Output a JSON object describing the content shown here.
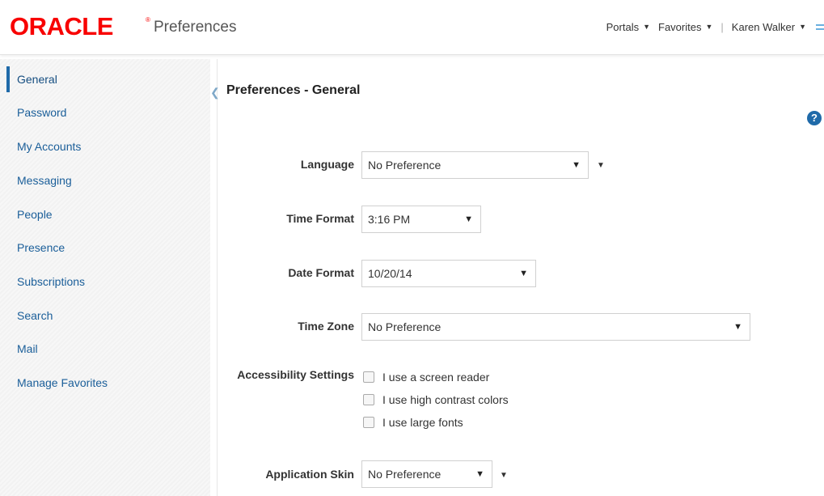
{
  "header": {
    "logo": "ORACLE",
    "logo_mark": "®",
    "title": "Preferences",
    "nav": [
      {
        "label": "Portals",
        "icon": "caret-down-icon"
      },
      {
        "label": "Favorites",
        "icon": "caret-down-icon"
      },
      {
        "label": "Karen Walker",
        "icon": "caret-down-icon"
      }
    ],
    "separator": "|"
  },
  "sidebar": {
    "items": [
      {
        "label": "General",
        "active": true
      },
      {
        "label": "Password"
      },
      {
        "label": "My Accounts"
      },
      {
        "label": "Messaging"
      },
      {
        "label": "People"
      },
      {
        "label": "Presence"
      },
      {
        "label": "Subscriptions"
      },
      {
        "label": "Search"
      },
      {
        "label": "Mail"
      },
      {
        "label": "Manage Favorites"
      }
    ]
  },
  "main": {
    "title": "Preferences - General",
    "help": "?",
    "fields": {
      "language": {
        "label": "Language",
        "value": "No Preference"
      },
      "time_format": {
        "label": "Time Format",
        "value": "3:16 PM"
      },
      "date_format": {
        "label": "Date Format",
        "value": "10/20/14"
      },
      "time_zone": {
        "label": "Time Zone",
        "value": "No Preference"
      },
      "accessibility": {
        "label": "Accessibility Settings",
        "options": [
          {
            "label": "I use a screen reader",
            "checked": false
          },
          {
            "label": "I use high contrast colors",
            "checked": false
          },
          {
            "label": "I use large fonts",
            "checked": false
          }
        ]
      },
      "skin": {
        "label": "Application Skin",
        "value": "No Preference"
      }
    }
  },
  "colors": {
    "brand": "#f80000",
    "link": "#1a5e99",
    "accent": "#1f6aa9"
  }
}
